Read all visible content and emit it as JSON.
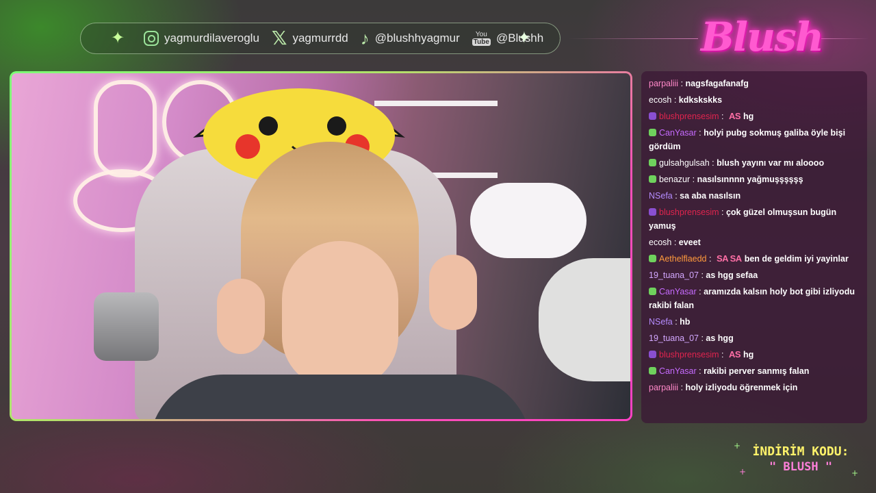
{
  "social_bar": {
    "items": [
      {
        "icon": "instagram-icon",
        "handle": "yagmurdilaveroglu"
      },
      {
        "icon": "x-icon",
        "handle": "yagmurrdd"
      },
      {
        "icon": "tiktok-icon",
        "handle": "@blushhyagmur"
      },
      {
        "icon": "youtube-icon",
        "handle": "@Blushh"
      }
    ],
    "youtube_icon_text": {
      "top": "You",
      "bottom": "Tube"
    }
  },
  "logo": {
    "text": "Blush",
    "color": "#ff5ad0"
  },
  "chat": {
    "messages": [
      {
        "user": "parpaliii",
        "user_color": "#ff88c8",
        "text": "nagsfagafanafg"
      },
      {
        "user": "ecosh",
        "user_color": "#ffffff",
        "text": "kdkskskks"
      },
      {
        "user": "blushprensesim",
        "user_color": "#e0244e",
        "emote": "AS",
        "text": "hg"
      },
      {
        "user": "CanYasar",
        "user_color": "#c66bff",
        "text": "holyi pubg sokmuş galiba öyle bişi gördüm"
      },
      {
        "user": "gulsahgulsah",
        "user_color": "#ffffff",
        "text": "blush yayını var mı aloooo"
      },
      {
        "user": "benazur",
        "user_color": "#ffffff",
        "text": "nasılsınnnn yağmuşşşşşş"
      },
      {
        "user": "NSefa",
        "user_color": "#b58cff",
        "text": "sa aba nasılsın"
      },
      {
        "user": "blushprensesim",
        "user_color": "#e0244e",
        "text": "çok güzel olmuşsun bugün yamuş"
      },
      {
        "user": "ecosh",
        "user_color": "#ffffff",
        "text": "eveet"
      },
      {
        "user": "Aethelflaedd",
        "user_color": "#ff9a3c",
        "emote": "SA SA",
        "text": "ben de geldim iyi yayinlar"
      },
      {
        "user": "19_tuana_07",
        "user_color": "#d3a8ff",
        "text": "as hgg sefaa"
      },
      {
        "user": "CanYasar",
        "user_color": "#c66bff",
        "text": "aramızda kalsın holy bot gibi izliyodu rakibi falan"
      },
      {
        "user": "NSefa",
        "user_color": "#b58cff",
        "text": "hb"
      },
      {
        "user": "19_tuana_07",
        "user_color": "#d3a8ff",
        "text": "as hgg"
      },
      {
        "user": "blushprensesim",
        "user_color": "#e0244e",
        "emote": "AS",
        "text": "hg"
      },
      {
        "user": "CanYasar",
        "user_color": "#c66bff",
        "text": "rakibi perver sanmış falan"
      },
      {
        "user": "parpaliii",
        "user_color": "#ff88c8",
        "text": "holy izliyodu öğrenmek için"
      }
    ]
  },
  "promo": {
    "line1": "İNDİRİM KODU:",
    "line2": "\" BLUSH \""
  },
  "colors": {
    "accent_green": "#7dff77",
    "accent_pink": "#ff41c4"
  }
}
